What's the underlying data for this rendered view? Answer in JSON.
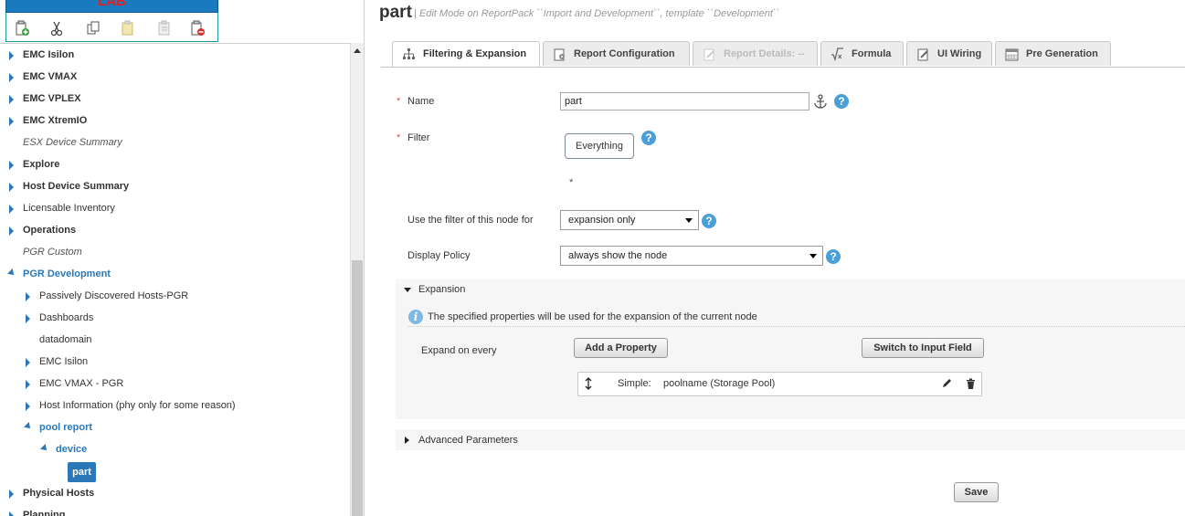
{
  "app": {
    "logo_text": "LAB",
    "title": "part",
    "subtitle": "| Edit Mode on ReportPack ``Import and Development``, template ``Development``"
  },
  "toolbar_icons": [
    "add-node-icon",
    "cut-icon",
    "copy-icon",
    "paste-icon",
    "paste-child-icon",
    "delete-node-icon"
  ],
  "tree": {
    "items": [
      {
        "label": "EMC Isilon"
      },
      {
        "label": "EMC VMAX"
      },
      {
        "label": "EMC VPLEX"
      },
      {
        "label": "EMC XtremIO"
      },
      {
        "label": "ESX Device Summary"
      },
      {
        "label": "Explore"
      },
      {
        "label": "Host Device Summary"
      },
      {
        "label": "Licensable Inventory"
      },
      {
        "label": "Operations"
      },
      {
        "label": "PGR Custom"
      },
      {
        "label": "PGR Development"
      },
      {
        "label": "Passively Discovered Hosts-PGR"
      },
      {
        "label": "Dashboards"
      },
      {
        "label": "datadomain"
      },
      {
        "label": "EMC Isilon"
      },
      {
        "label": "EMC VMAX - PGR"
      },
      {
        "label": "Host Information (phy only for some reason)"
      },
      {
        "label": "pool report"
      },
      {
        "label": "device"
      },
      {
        "label": "part"
      },
      {
        "label": "Physical Hosts"
      },
      {
        "label": "Planning"
      }
    ]
  },
  "tabs": [
    {
      "label": "Filtering & Expansion"
    },
    {
      "label": "Report Configuration"
    },
    {
      "label": "Report Details: --"
    },
    {
      "label": "Formula"
    },
    {
      "label": "UI Wiring"
    },
    {
      "label": "Pre Generation"
    }
  ],
  "form": {
    "required_mark": "*",
    "name_label": "Name",
    "name_value": "part",
    "filter_label": "Filter",
    "filter_button": "Everything",
    "filter_asterisk": "*",
    "use_filter_label": "Use the filter of this node for",
    "use_filter_value": "expansion only",
    "display_policy_label": "Display Policy",
    "display_policy_value": "always show the node",
    "help_glyph": "?"
  },
  "expansion": {
    "header": "Expansion",
    "info_text": "The specified properties will be used for the expansion of the current node",
    "expand_label": "Expand on every",
    "add_property": "Add a Property",
    "switch_input": "Switch to Input Field",
    "row_type": "Simple:",
    "row_value": "poolname (Storage Pool)"
  },
  "advanced": {
    "header": "Advanced Parameters"
  },
  "save_label": "Save",
  "colors": {
    "accent": "#2a78b8",
    "help": "#4a9fd8",
    "required": "#d9534f",
    "logo_bg": "#1a7ac0"
  }
}
